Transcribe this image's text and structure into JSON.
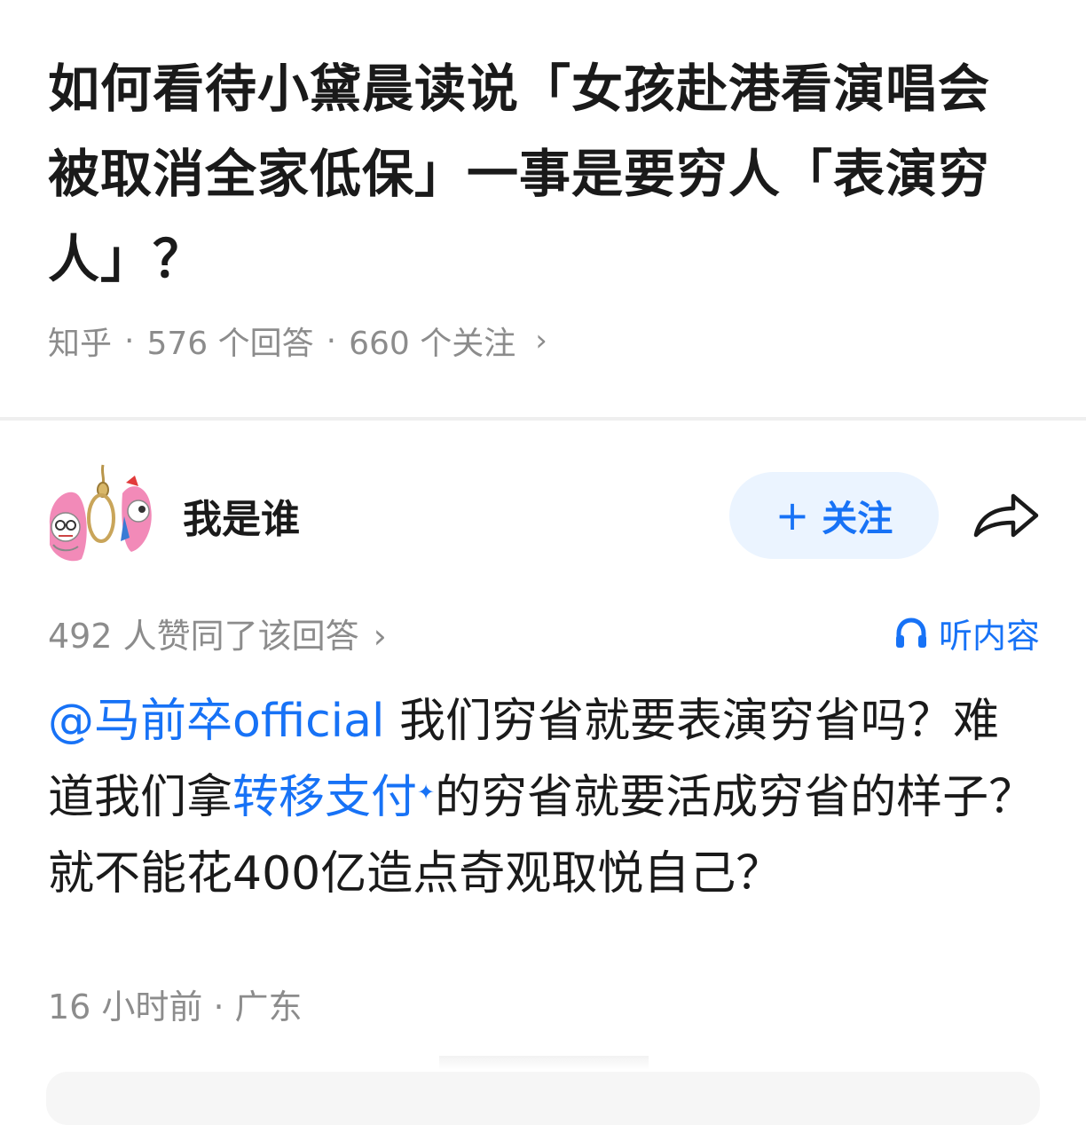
{
  "question": {
    "title": "如何看待小黛晨读说「女孩赴港看演唱会被取消全家低保」一事是要穷人「表演穷人」？",
    "source": "知乎",
    "answers": "576 个回答",
    "followers": "660 个关注",
    "chevron": "›"
  },
  "author": {
    "name": "我是谁",
    "avatar_icon": "cartoon-avatar-icon"
  },
  "follow_button": {
    "plus": "+",
    "label": "关注"
  },
  "share_icon": "share-arrow-icon",
  "answer": {
    "votes": "492 人赞同了该回答",
    "votes_chevron": "›",
    "listen_label": "听内容",
    "listen_icon": "headphones-icon",
    "mention": "@马前卒official",
    "text_1": " 我们穷省就要表演穷省吗？难道我们拿",
    "link_text": "转移支付",
    "link_mark": "✦",
    "text_2": "的穷省就要活成穷省的样子？就不能花400亿造点奇观取悦自己？",
    "time": "16 小时前",
    "location": "广东"
  },
  "colors": {
    "accent": "#1772f6",
    "muted": "#8c8c8c",
    "text": "#1a1a1a",
    "follow_bg": "#ebf4ff"
  }
}
